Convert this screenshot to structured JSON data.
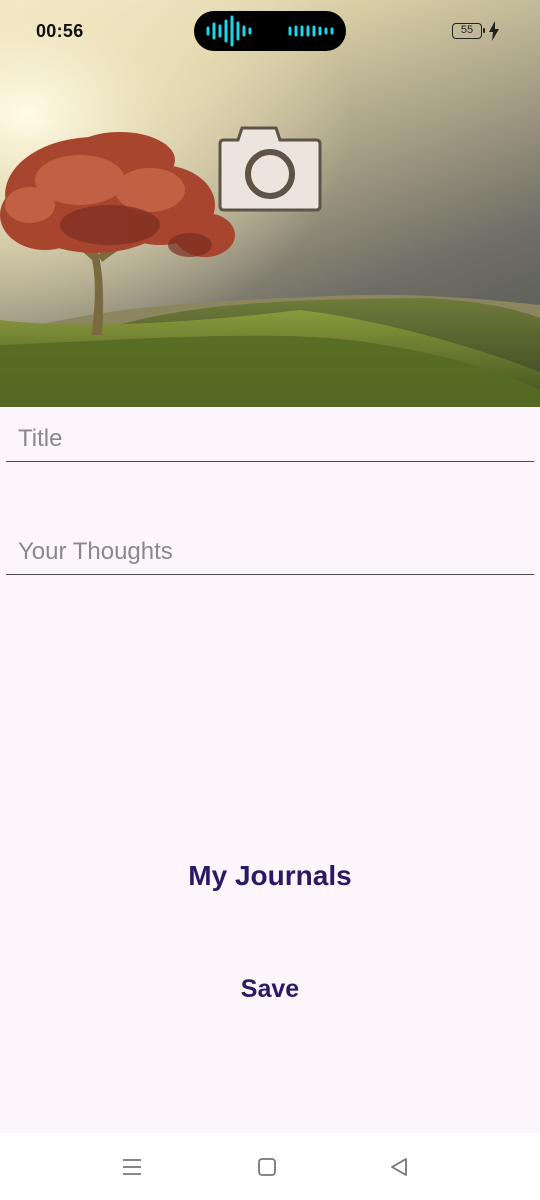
{
  "status_bar": {
    "time": "00:56",
    "battery": "55"
  },
  "hero": {
    "image": "landscape with red tree on green hills at sunset",
    "camera_icon": "camera-icon"
  },
  "form": {
    "title_placeholder": "Title",
    "thoughts_placeholder": "Your Thoughts"
  },
  "actions": {
    "journals_label": "My Journals",
    "save_label": "Save"
  },
  "nav": {
    "icons": [
      "menu-icon",
      "home-icon",
      "back-icon"
    ]
  },
  "colors": {
    "background": "#fcf6fc",
    "accent_text": "#2a1a66",
    "placeholder": "#8c878f"
  }
}
